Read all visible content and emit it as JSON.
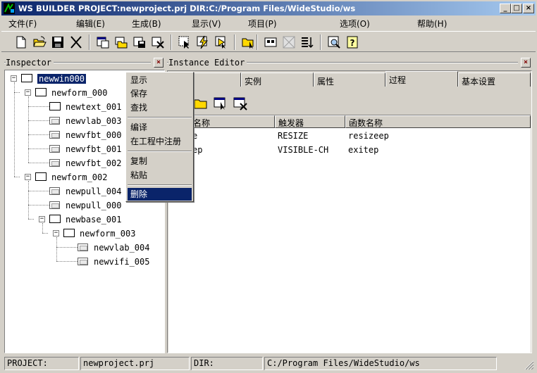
{
  "window": {
    "title": "WS BUILDER PROJECT:newproject.prj DIR:C:/Program Files/WideStudio/ws"
  },
  "menubar": [
    "文件(F)",
    "编辑(E)",
    "生成(B)",
    "显示(V)",
    "项目(P)",
    "选项(O)",
    "帮助(H)"
  ],
  "inspector": {
    "title": "Inspector"
  },
  "tree": {
    "nodes": [
      {
        "label": "newwin000",
        "selected": true
      },
      {
        "label": "newform_000"
      },
      {
        "label": "newtext_001"
      },
      {
        "label": "newvlab_003"
      },
      {
        "label": "newvfbt_000"
      },
      {
        "label": "newvfbt_001"
      },
      {
        "label": "newvfbt_002"
      },
      {
        "label": "newform_002"
      },
      {
        "label": "newpull_004"
      },
      {
        "label": "newpull_000"
      },
      {
        "label": "newbase_001"
      },
      {
        "label": "newform_003"
      },
      {
        "label": "newvlab_004"
      },
      {
        "label": "newvifi_005"
      }
    ]
  },
  "context_menu": {
    "items": [
      "显示",
      "保存",
      "查找",
      "编译",
      "在工程中注册",
      "复制",
      "粘贴",
      "删除"
    ],
    "active": "删除"
  },
  "editor": {
    "title": "Instance Editor",
    "tabs": [
      "",
      "实例",
      "属性",
      "过程",
      "基本设置"
    ],
    "columns": [
      "名称",
      "触发器",
      "函数名称"
    ],
    "rows": [
      [
        "e",
        "RESIZE",
        "resizeep"
      ],
      [
        "ep",
        "VISIBLE-CH",
        "exitep"
      ]
    ]
  },
  "statusbar": {
    "project_label": "PROJECT:",
    "project_value": "newproject.prj",
    "dir_label": "DIR:",
    "dir_value": "C:/Program Files/WideStudio/ws"
  }
}
